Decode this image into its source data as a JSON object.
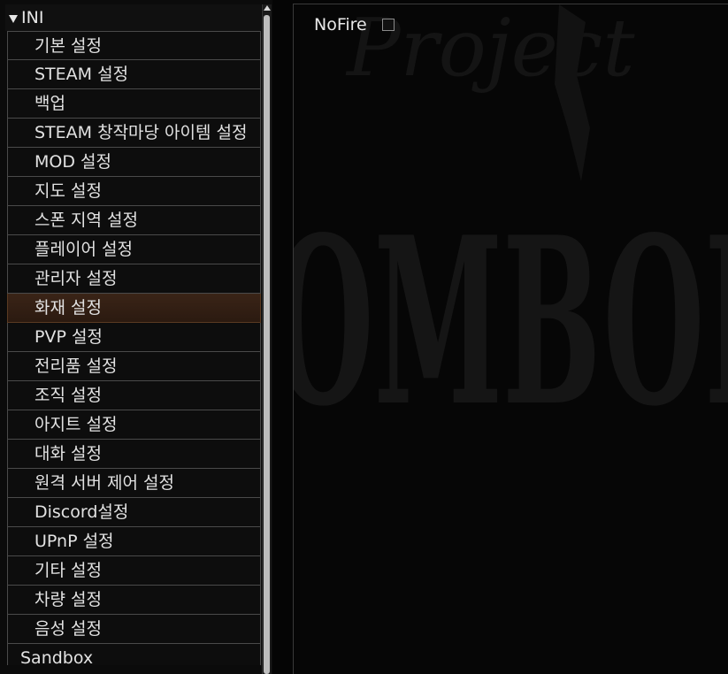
{
  "tree": {
    "root_label": "INI",
    "items": [
      {
        "label": "기본 설정"
      },
      {
        "label": "STEAM 설정"
      },
      {
        "label": "백업"
      },
      {
        "label": "STEAM 창작마당 아이템 설정"
      },
      {
        "label": "MOD 설정"
      },
      {
        "label": "지도 설정"
      },
      {
        "label": "스폰 지역 설정"
      },
      {
        "label": "플레이어 설정"
      },
      {
        "label": "관리자 설정"
      },
      {
        "label": "화재 설정",
        "selected": true
      },
      {
        "label": "PVP 설정"
      },
      {
        "label": "전리품 설정"
      },
      {
        "label": "조직 설정"
      },
      {
        "label": "아지트 설정"
      },
      {
        "label": "대화 설정"
      },
      {
        "label": "원격 서버 제어 설정"
      },
      {
        "label": "Discord설정"
      },
      {
        "label": "UPnP 설정"
      },
      {
        "label": "기타 설정"
      },
      {
        "label": "차량 설정"
      },
      {
        "label": "음성 설정"
      }
    ],
    "next_section_partial": "Sandbox"
  },
  "settings": {
    "nofire": {
      "label": "NoFire",
      "checked": false
    }
  },
  "background": {
    "watermark_top": "Project",
    "watermark_main": "ZOMBOID"
  },
  "colors": {
    "selected_item": "#3a2417",
    "item_border": "#4a4a4a",
    "text": "#e2e2e2"
  }
}
